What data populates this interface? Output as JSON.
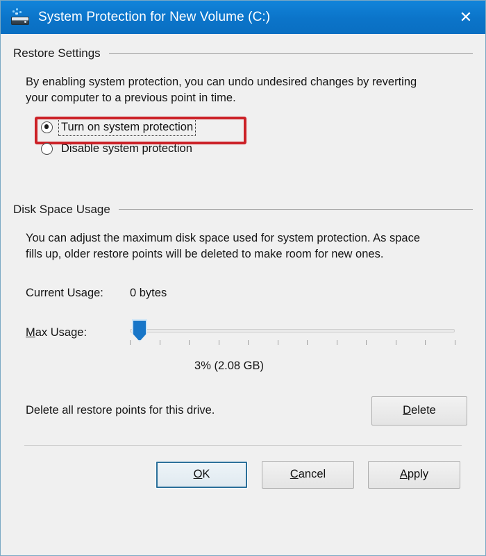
{
  "window": {
    "title": "System Protection for New Volume (C:)",
    "icon": "hard-drive-restore-icon",
    "close_label": "✕",
    "titlebar_color": "#0b78d0"
  },
  "restore_settings": {
    "group_label": "Restore Settings",
    "description": "By enabling system protection, you can undo undesired changes by reverting your computer to a previous point in time.",
    "options": [
      {
        "label": "Turn on system protection",
        "selected": true,
        "focused": true
      },
      {
        "label": "Disable system protection",
        "selected": false,
        "focused": false
      }
    ],
    "highlight_color": "#cc2127"
  },
  "disk_space_usage": {
    "group_label": "Disk Space Usage",
    "description": "You can adjust the maximum disk space used for system protection. As space fills up, older restore points will be deleted to make room for new ones.",
    "current_usage_label": "Current Usage:",
    "current_usage_value": "0 bytes",
    "max_usage_label_prefix": "M",
    "max_usage_label_rest": "ax Usage:",
    "slider": {
      "percent": 3,
      "min": 0,
      "max": 100,
      "tick_count": 12,
      "thumb_color": "#1876c8"
    },
    "usage_readout": "3% (2.08 GB)",
    "delete_text": "Delete all restore points for this drive.",
    "delete_button_prefix": "D",
    "delete_button_rest": "elete"
  },
  "footer": {
    "ok_prefix": "O",
    "ok_rest": "K",
    "cancel_prefix": "C",
    "cancel_rest": "ancel",
    "apply_prefix": "A",
    "apply_rest": "pply"
  }
}
